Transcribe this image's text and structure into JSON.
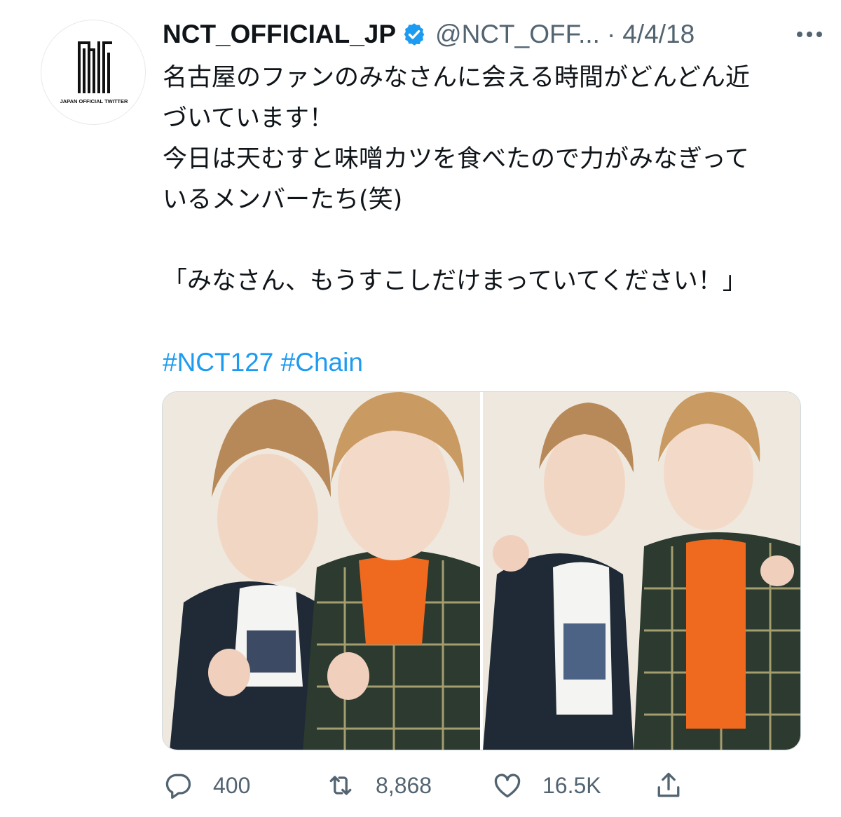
{
  "tweet": {
    "display_name": "NCT_OFFICIAL_JP",
    "handle": "@NCT_OFF...",
    "separator": "·",
    "date": "4/4/18",
    "avatar": {
      "logo_text": "nct",
      "caption": "JAPAN OFFICIAL TWITTER"
    },
    "lines": [
      "名古屋のファンのみなさんに会える時間がどんどん近",
      "づいています！",
      "今日は天むすと味噌カツを食べたので力がみなぎって",
      "いるメンバーたち(笑)",
      "「みなさん、もうすこしだけまっていてください！」"
    ],
    "hashtags": [
      "#NCT127",
      "#Chain"
    ],
    "stats": {
      "replies": "400",
      "retweets": "8,868",
      "likes": "16.5K"
    }
  },
  "colors": {
    "text": "#0f1419",
    "secondary": "#536471",
    "link": "#1d9bf0",
    "verified": "#1d9bf0"
  },
  "icons": {
    "more": "more-icon",
    "verified": "verified-badge-icon",
    "reply": "reply-icon",
    "retweet": "retweet-icon",
    "like": "heart-icon",
    "share": "share-icon"
  }
}
